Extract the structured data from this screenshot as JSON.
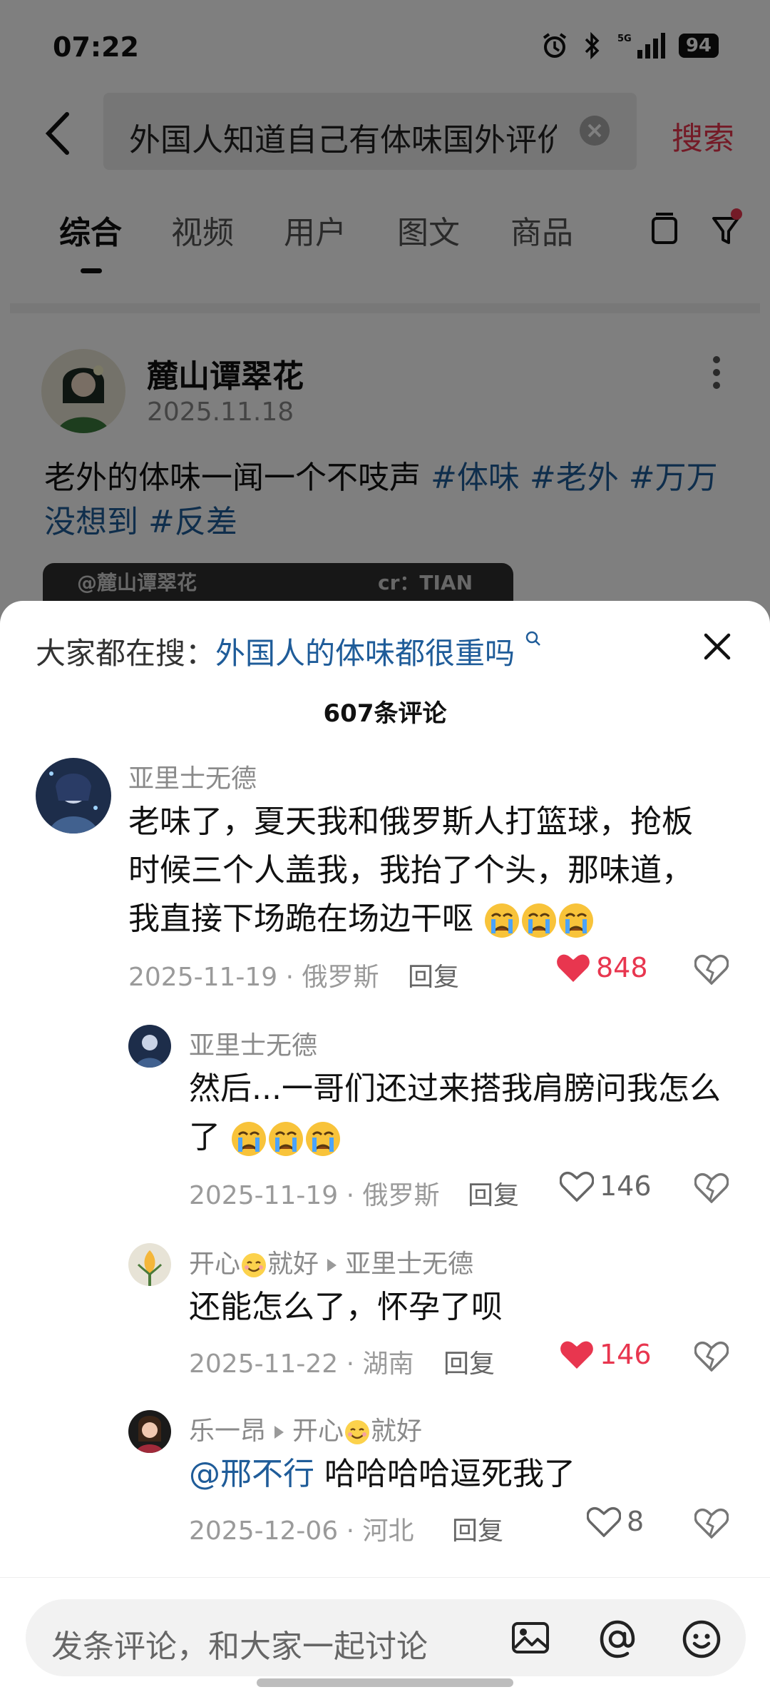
{
  "status": {
    "time": "07:22",
    "battery": "94",
    "network": "5G"
  },
  "search": {
    "query": "外国人知道自己有体味国外评价",
    "submit_label": "搜索"
  },
  "tabs": [
    {
      "label": "综合"
    },
    {
      "label": "视频"
    },
    {
      "label": "用户"
    },
    {
      "label": "图文"
    },
    {
      "label": "商品"
    }
  ],
  "post": {
    "author": "麓山谭翠花",
    "date": "2025.11.18",
    "text": "老外的体味一闻一个不吱声",
    "hashtags": [
      "#体味",
      "#老外",
      "#万万没想到",
      "#反差"
    ],
    "thumb_watermark": "@麓山谭翠花",
    "thumb_credit": "cr：TIAN"
  },
  "sheet": {
    "hint_prefix": "大家都在搜：",
    "hint_link": "外国人的体味都很重吗",
    "comment_count": "607条评论"
  },
  "comments": [
    {
      "name": "亚里士无德",
      "text": "老味了，夏天我和俄罗斯人打篮球，抢板时候三个人盖我，我抬了个头，那味道，我直接下场跪在场边干呕",
      "emoji": "crying-face-icon ×3",
      "meta": "2025-11-19 · 俄罗斯",
      "reply_label": "回复",
      "likes": "848",
      "liked": true
    },
    {
      "name": "亚里士无德",
      "text": "然后...一哥们还过来搭我肩膀问我怎么了",
      "emoji": "crying-face-icon ×3",
      "meta": "2025-11-19 · 俄罗斯",
      "reply_label": "回复",
      "likes": "146",
      "liked": false
    },
    {
      "name": "开心",
      "name_suffix": "就好",
      "reply_to": "亚里士无德",
      "text": "还能怎么了，怀孕了呗",
      "meta": "2025-11-22 · 湖南",
      "reply_label": "回复",
      "likes": "146",
      "liked": true
    },
    {
      "name": "乐一昂",
      "reply_to": "开心",
      "reply_to_suffix": "就好",
      "mention": "@邢不行",
      "text": " 哈哈哈哈逗死我了",
      "meta": "2025-12-06 · 河北",
      "reply_label": "回复",
      "likes": "8",
      "liked": false
    }
  ],
  "input": {
    "placeholder": "发条评论，和大家一起讨论"
  },
  "colors": {
    "accent": "#e8364f",
    "link": "#1f5c99"
  }
}
